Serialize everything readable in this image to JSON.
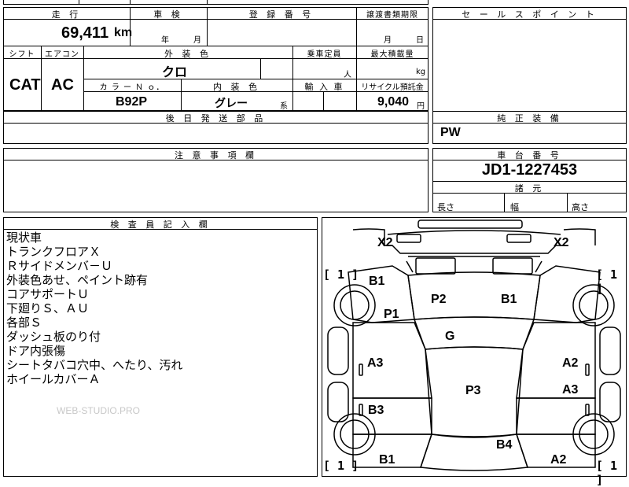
{
  "top_strip": {},
  "row1": {
    "mileage_header": "走 行",
    "mileage_value": "69,411",
    "mileage_unit": "km",
    "inspection_header": "車 検",
    "inspection_year_unit": "年",
    "inspection_month_unit": "月",
    "registration_header": "登 録 番 号",
    "transfer_header": "譲渡書類期限",
    "transfer_month_unit": "月",
    "transfer_day_unit": "日"
  },
  "row2": {
    "shift_header": "シフト",
    "shift_value": "CAT",
    "ac_header": "エアコン",
    "ac_value": "AC",
    "exterior_header": "外 装 色",
    "exterior_value": "クロ",
    "capacity_header": "乗車定員",
    "capacity_unit": "人",
    "maxload_header": "最大積載量",
    "maxload_unit": "kg",
    "colorno_header": "カ ラ ー Ｎ ｏ．",
    "colorno_value": "B92P",
    "interior_header": "内 装 色",
    "interior_value": "グレー",
    "interior_suffix": "系",
    "import_header": "輸 入 車",
    "recycle_header": "リサイクル預託金",
    "recycle_value": "9,040",
    "recycle_unit": "円"
  },
  "later_parts": {
    "header": "後 日 発 送 部 品"
  },
  "sales_point": {
    "header": "セ ー ル ス ポ イ ン ト"
  },
  "genuine_equipment": {
    "header": "純 正 装 備",
    "value": "PW"
  },
  "caution": {
    "header": "注 意 事 項 欄"
  },
  "chassis": {
    "header": "車 台 番 号",
    "value": "JD1-1227453",
    "dims_header": "諸 元",
    "length_label": "長さ",
    "width_label": "幅",
    "height_label": "高さ"
  },
  "inspector": {
    "header": "検 査 員 記 入 欄",
    "notes": [
      "現状車",
      "トランクフロアＸ",
      "Ｒサイドメンバ－Ｕ",
      "外装色あせ、ペイント跡有",
      "コアサポートＵ",
      "下廻りＳ、ＡＵ",
      "各部Ｓ",
      "ダッシュ板のり付",
      "ドア内張傷",
      "シートタバコ穴中、へたり、汚れ",
      "ホイールカバーＡ"
    ],
    "watermark": "WEB-STUDIO.PRO"
  },
  "diagram": {
    "marks": {
      "x2_left": "X2",
      "x2_right": "X2",
      "bracket_tl": "[ 1 ]",
      "bracket_tr": "[ 1 ]",
      "bracket_bl": "[ 1 ]",
      "bracket_br": "[ 1 ]",
      "b1_left": "B1",
      "p2": "P2",
      "b1_hood": "B1",
      "p1": "P1",
      "g": "G",
      "a3_left": "A3",
      "a2_right": "A2",
      "p3": "P3",
      "a3_right": "A3",
      "b3": "B3",
      "b4": "B4",
      "b1_bottom": "B1",
      "a2_bottom": "A2"
    }
  }
}
